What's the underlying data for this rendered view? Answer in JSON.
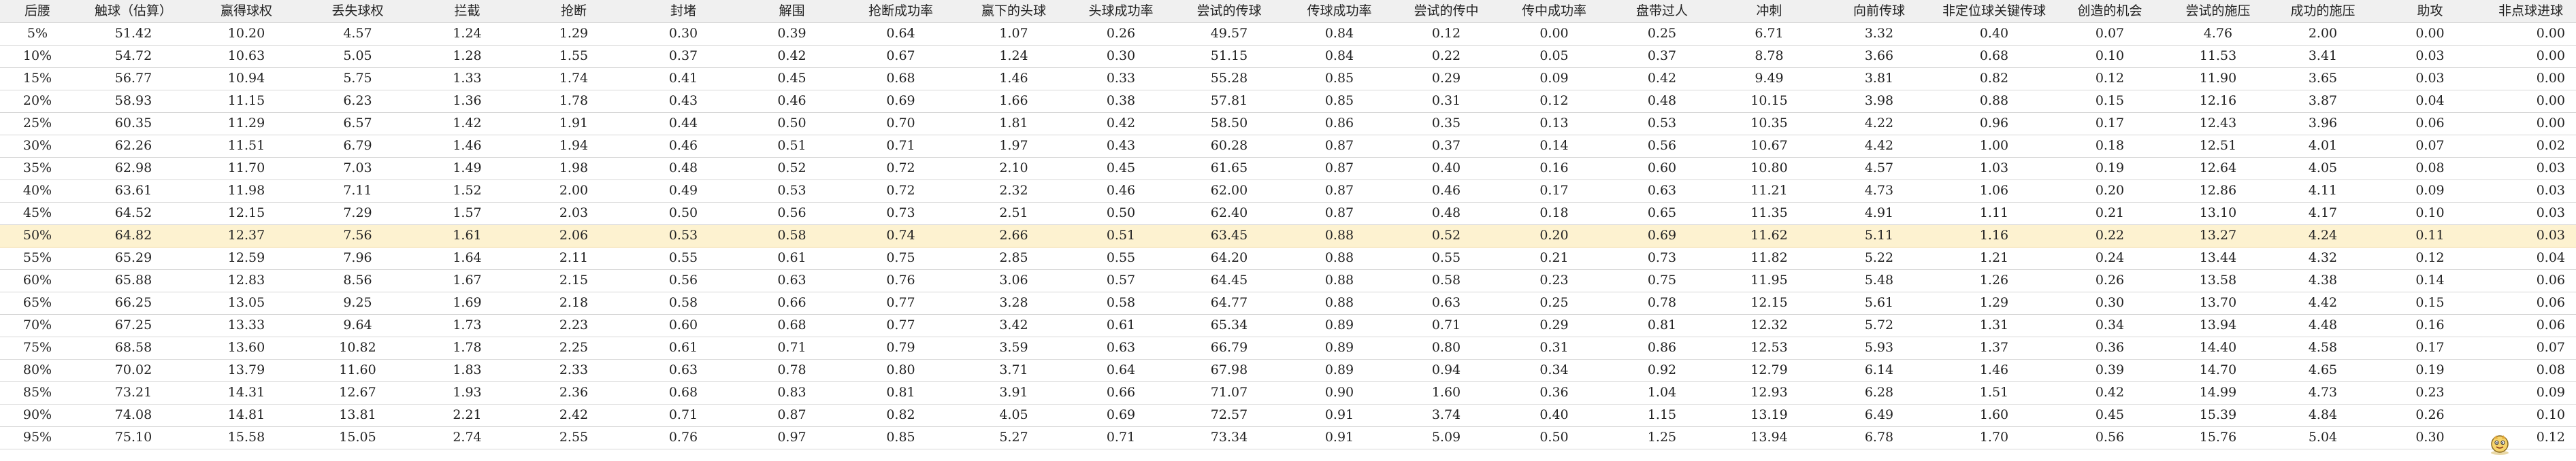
{
  "table": {
    "headers": [
      "后腰",
      "触球（估算）",
      "赢得球权",
      "丢失球权",
      "拦截",
      "抢断",
      "封堵",
      "解围",
      "抢断成功率",
      "赢下的头球",
      "头球成功率",
      "尝试的传球",
      "传球成功率",
      "尝试的传中",
      "传中成功率",
      "盘带过人",
      "冲刺",
      "向前传球",
      "非定位球关键传球",
      "创造的机会",
      "尝试的施压",
      "成功的施压",
      "助攻",
      "非点球进球"
    ],
    "highlight_row": 9,
    "rows": [
      [
        "5%",
        "51.42",
        "10.20",
        "4.57",
        "1.24",
        "1.29",
        "0.30",
        "0.39",
        "0.64",
        "1.07",
        "0.26",
        "49.57",
        "0.84",
        "0.12",
        "0.00",
        "0.25",
        "6.71",
        "3.32",
        "0.40",
        "0.07",
        "4.76",
        "2.00",
        "0.00",
        "0.00"
      ],
      [
        "10%",
        "54.72",
        "10.63",
        "5.05",
        "1.28",
        "1.55",
        "0.37",
        "0.42",
        "0.67",
        "1.24",
        "0.30",
        "51.15",
        "0.84",
        "0.22",
        "0.05",
        "0.37",
        "8.78",
        "3.66",
        "0.68",
        "0.10",
        "11.53",
        "3.41",
        "0.03",
        "0.00"
      ],
      [
        "15%",
        "56.77",
        "10.94",
        "5.75",
        "1.33",
        "1.74",
        "0.41",
        "0.45",
        "0.68",
        "1.46",
        "0.33",
        "55.28",
        "0.85",
        "0.29",
        "0.09",
        "0.42",
        "9.49",
        "3.81",
        "0.82",
        "0.12",
        "11.90",
        "3.65",
        "0.03",
        "0.00"
      ],
      [
        "20%",
        "58.93",
        "11.15",
        "6.23",
        "1.36",
        "1.78",
        "0.43",
        "0.46",
        "0.69",
        "1.66",
        "0.38",
        "57.81",
        "0.85",
        "0.31",
        "0.12",
        "0.48",
        "10.15",
        "3.98",
        "0.88",
        "0.15",
        "12.16",
        "3.87",
        "0.04",
        "0.00"
      ],
      [
        "25%",
        "60.35",
        "11.29",
        "6.57",
        "1.42",
        "1.91",
        "0.44",
        "0.50",
        "0.70",
        "1.81",
        "0.42",
        "58.50",
        "0.86",
        "0.35",
        "0.13",
        "0.53",
        "10.35",
        "4.22",
        "0.96",
        "0.17",
        "12.43",
        "3.96",
        "0.06",
        "0.00"
      ],
      [
        "30%",
        "62.26",
        "11.51",
        "6.79",
        "1.46",
        "1.94",
        "0.46",
        "0.51",
        "0.71",
        "1.97",
        "0.43",
        "60.28",
        "0.87",
        "0.37",
        "0.14",
        "0.56",
        "10.67",
        "4.42",
        "1.00",
        "0.18",
        "12.51",
        "4.01",
        "0.07",
        "0.02"
      ],
      [
        "35%",
        "62.98",
        "11.70",
        "7.03",
        "1.49",
        "1.98",
        "0.48",
        "0.52",
        "0.72",
        "2.10",
        "0.45",
        "61.65",
        "0.87",
        "0.40",
        "0.16",
        "0.60",
        "10.80",
        "4.57",
        "1.03",
        "0.19",
        "12.64",
        "4.05",
        "0.08",
        "0.03"
      ],
      [
        "40%",
        "63.61",
        "11.98",
        "7.11",
        "1.52",
        "2.00",
        "0.49",
        "0.53",
        "0.72",
        "2.32",
        "0.46",
        "62.00",
        "0.87",
        "0.46",
        "0.17",
        "0.63",
        "11.21",
        "4.73",
        "1.06",
        "0.20",
        "12.86",
        "4.11",
        "0.09",
        "0.03"
      ],
      [
        "45%",
        "64.52",
        "12.15",
        "7.29",
        "1.57",
        "2.03",
        "0.50",
        "0.56",
        "0.73",
        "2.51",
        "0.50",
        "62.40",
        "0.87",
        "0.48",
        "0.18",
        "0.65",
        "11.35",
        "4.91",
        "1.11",
        "0.21",
        "13.10",
        "4.17",
        "0.10",
        "0.03"
      ],
      [
        "50%",
        "64.82",
        "12.37",
        "7.56",
        "1.61",
        "2.06",
        "0.53",
        "0.58",
        "0.74",
        "2.66",
        "0.51",
        "63.45",
        "0.88",
        "0.52",
        "0.20",
        "0.69",
        "11.62",
        "5.11",
        "1.16",
        "0.22",
        "13.27",
        "4.24",
        "0.11",
        "0.03"
      ],
      [
        "55%",
        "65.29",
        "12.59",
        "7.96",
        "1.64",
        "2.11",
        "0.55",
        "0.61",
        "0.75",
        "2.85",
        "0.55",
        "64.20",
        "0.88",
        "0.55",
        "0.21",
        "0.73",
        "11.82",
        "5.22",
        "1.21",
        "0.24",
        "13.44",
        "4.32",
        "0.12",
        "0.04"
      ],
      [
        "60%",
        "65.88",
        "12.83",
        "8.56",
        "1.67",
        "2.15",
        "0.56",
        "0.63",
        "0.76",
        "3.06",
        "0.57",
        "64.45",
        "0.88",
        "0.58",
        "0.23",
        "0.75",
        "11.95",
        "5.48",
        "1.26",
        "0.26",
        "13.58",
        "4.38",
        "0.14",
        "0.06"
      ],
      [
        "65%",
        "66.25",
        "13.05",
        "9.25",
        "1.69",
        "2.18",
        "0.58",
        "0.66",
        "0.77",
        "3.28",
        "0.58",
        "64.77",
        "0.88",
        "0.63",
        "0.25",
        "0.78",
        "12.15",
        "5.61",
        "1.29",
        "0.30",
        "13.70",
        "4.42",
        "0.15",
        "0.06"
      ],
      [
        "70%",
        "67.25",
        "13.33",
        "9.64",
        "1.73",
        "2.23",
        "0.60",
        "0.68",
        "0.77",
        "3.42",
        "0.61",
        "65.34",
        "0.89",
        "0.71",
        "0.29",
        "0.81",
        "12.32",
        "5.72",
        "1.31",
        "0.34",
        "13.94",
        "4.48",
        "0.16",
        "0.06"
      ],
      [
        "75%",
        "68.58",
        "13.60",
        "10.82",
        "1.78",
        "2.25",
        "0.61",
        "0.71",
        "0.79",
        "3.59",
        "0.63",
        "66.79",
        "0.89",
        "0.80",
        "0.31",
        "0.86",
        "12.53",
        "5.93",
        "1.37",
        "0.36",
        "14.40",
        "4.58",
        "0.17",
        "0.07"
      ],
      [
        "80%",
        "70.02",
        "13.79",
        "11.60",
        "1.83",
        "2.33",
        "0.63",
        "0.78",
        "0.80",
        "3.71",
        "0.64",
        "67.98",
        "0.89",
        "0.94",
        "0.34",
        "0.92",
        "12.79",
        "6.14",
        "1.46",
        "0.39",
        "14.70",
        "4.65",
        "0.19",
        "0.08"
      ],
      [
        "85%",
        "73.21",
        "14.31",
        "12.67",
        "1.93",
        "2.36",
        "0.68",
        "0.83",
        "0.81",
        "3.91",
        "0.66",
        "71.07",
        "0.90",
        "1.60",
        "0.36",
        "1.04",
        "12.93",
        "6.28",
        "1.51",
        "0.42",
        "14.99",
        "4.73",
        "0.23",
        "0.09"
      ],
      [
        "90%",
        "74.08",
        "14.81",
        "13.81",
        "2.21",
        "2.42",
        "0.71",
        "0.87",
        "0.82",
        "4.05",
        "0.69",
        "72.57",
        "0.91",
        "3.74",
        "0.40",
        "1.15",
        "13.19",
        "6.49",
        "1.60",
        "0.45",
        "15.39",
        "4.84",
        "0.26",
        "0.10"
      ],
      [
        "95%",
        "75.10",
        "15.58",
        "15.05",
        "2.74",
        "2.55",
        "0.76",
        "0.97",
        "0.85",
        "5.27",
        "0.71",
        "73.34",
        "0.91",
        "5.09",
        "0.50",
        "1.25",
        "13.94",
        "6.78",
        "1.70",
        "0.56",
        "15.76",
        "5.04",
        "0.30",
        "0.12"
      ]
    ]
  },
  "corner_icon": "cartoon-mascot-icon"
}
